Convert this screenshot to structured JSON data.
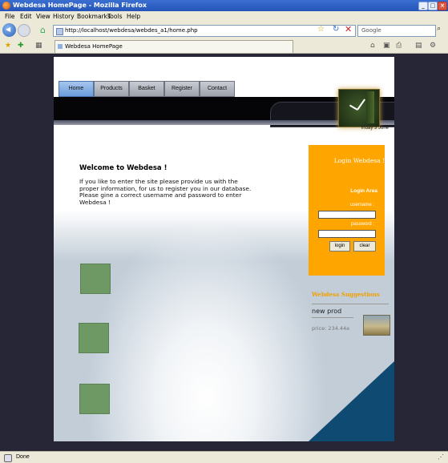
{
  "window": {
    "title": "Webdesa HomePage - Mozilla Firefox"
  },
  "menu": [
    "File",
    "Edit",
    "View",
    "History",
    "Bookmarks",
    "Tools",
    "Help"
  ],
  "navigation": {
    "url": "http://localhost/webdesa/webdes_a1/home.php",
    "search_placeholder": "Google"
  },
  "tab": {
    "label": "Webdesa HomePage"
  },
  "page": {
    "nav_tabs": [
      "Home",
      "Products",
      "Basket",
      "Register",
      "Contact"
    ],
    "date": "friday 3 June",
    "welcome_title": "Welcome to Webdesa !",
    "welcome_text": "If you like to enter the site please provide us with the proper information, for us to register you in our database. Please gine a correct username and password to enter Webdesa !",
    "login": {
      "title": "Login Webdesa !",
      "area": "Login Area",
      "username_label": "username :",
      "password_label": "password :",
      "login_button": "login",
      "clear_button": "clear"
    },
    "suggestions": {
      "title": "Webdesa Suggestions",
      "product_name": "new prod",
      "price": "price: 234.44e"
    }
  },
  "status": {
    "text": "Done"
  },
  "colors": {
    "login_bg": "#ffa500",
    "active_tab": "#6a9cdc",
    "corner": "#0f4a72",
    "squares": "#6e9964"
  }
}
